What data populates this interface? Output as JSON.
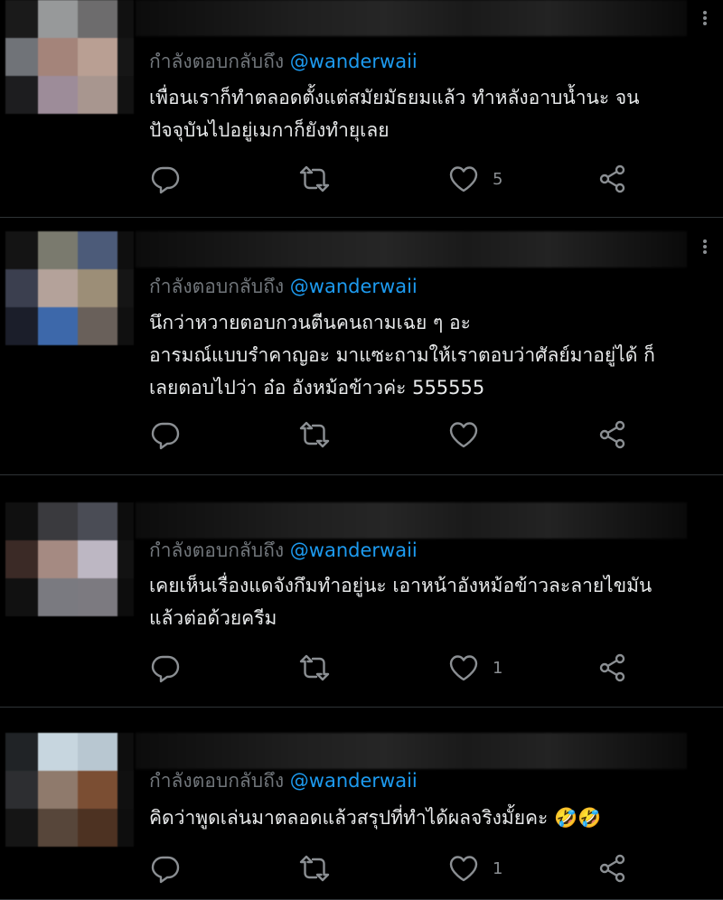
{
  "reply_prefix": "กำลังตอบกลับถึง",
  "tweets": [
    {
      "handle": "@wanderwaii",
      "lines": [
        "เพื่อนเราก็ทำตลอดตั้งแต่สมัยมัธยมแล้ว ทำหลังอาบน้ำนะ จน",
        "ปัจจุบันไปอยู่เมกาก็ยังทำยุเลย"
      ],
      "likes": "5"
    },
    {
      "handle": "@wanderwaii",
      "lines": [
        "นึกว่าหวายตอบกวนตีนคนถามเฉย ๆ อะ",
        "อารมณ์แบบรำคาญอะ มาแซะถามให้เราตอบว่าศัลย์มาอยู่ได้ ก็",
        "เลยตอบไปว่า อ๋อ อังหม้อข้าวค่ะ 555555"
      ],
      "likes": ""
    },
    {
      "handle": "@wanderwaii",
      "lines": [
        "เคยเห็นเรื่องแดจังกึมทำอยู่นะ เอาหน้าอังหม้อข้าวละลายไขมัน",
        "แล้วต่อด้วยครีม"
      ],
      "likes": "1"
    },
    {
      "handle": "@wanderwaii",
      "lines": [
        "คิดว่าพูดเล่นมาตลอดแล้วสรุปที่ทำได้ผลจริงมั้ยคะ 🤣🤣"
      ],
      "likes": "1"
    }
  ],
  "icons": {
    "reply": "reply-icon",
    "retweet": "retweet-icon",
    "like": "heart-icon",
    "share": "share-icon"
  },
  "colors": {
    "background": "#000000",
    "text": "#e7e9ea",
    "muted": "#71767b",
    "link": "#1d9bf0"
  }
}
